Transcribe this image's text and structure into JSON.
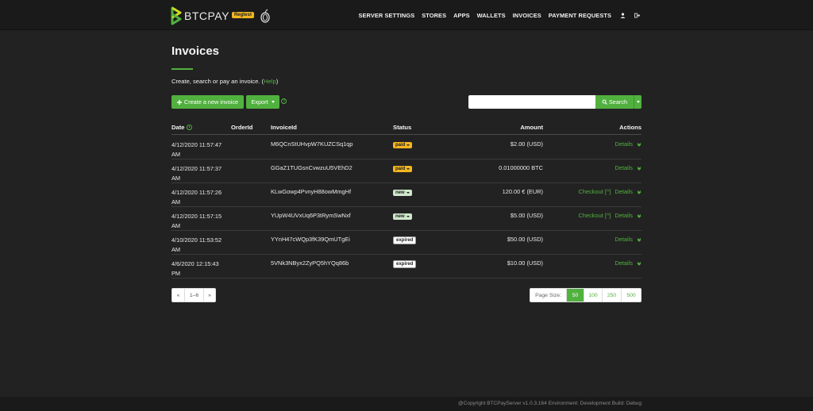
{
  "brand": {
    "name": "BTCPAY",
    "badge": "Regtest",
    "colors": {
      "accent": "#51b13e",
      "badge": "#f3b61f"
    }
  },
  "nav": {
    "items": [
      {
        "label": "SERVER SETTINGS"
      },
      {
        "label": "STORES"
      },
      {
        "label": "APPS"
      },
      {
        "label": "WALLETS"
      },
      {
        "label": "INVOICES"
      },
      {
        "label": "PAYMENT REQUESTS"
      }
    ],
    "icons": [
      "user-icon",
      "logout-icon"
    ]
  },
  "page": {
    "title": "Invoices",
    "subtitle_prefix": "Create, search or pay an invoice. (",
    "help_label": "Help",
    "subtitle_suffix": ")"
  },
  "toolbar": {
    "create_label": "Create a new invoice",
    "export_label": "Export",
    "search_value": "",
    "search_label": "Search"
  },
  "table": {
    "headers": {
      "date": "Date",
      "orderid": "OrderId",
      "invoiceid": "InvoiceId",
      "status": "Status",
      "amount": "Amount",
      "actions": "Actions"
    },
    "rows": [
      {
        "date": "4/12/2020 11:57:47 AM",
        "orderid": "",
        "invoiceid": "M6QCnStUHvpW7KUZCSq1qp",
        "status": "paid",
        "amount": "$2.00 (USD)",
        "checkout": "",
        "details": "Details"
      },
      {
        "date": "4/12/2020 11:57:37 AM",
        "orderid": "",
        "invoiceid": "GGaZ1TUGsnCvwzuU5VEhD2",
        "status": "paid",
        "amount": "0.01000000 BTC",
        "checkout": "",
        "details": "Details"
      },
      {
        "date": "4/12/2020 11:57:26 AM",
        "orderid": "",
        "invoiceid": "KLwGowp4PvnyH88owMmgHf",
        "status": "new",
        "amount": "120.00 € (EUR)",
        "checkout": "Checkout [^]",
        "details": "Details"
      },
      {
        "date": "4/12/2020 11:57:15 AM",
        "orderid": "",
        "invoiceid": "YUpW4UVxUq6P3tRymSwNxf",
        "status": "new",
        "amount": "$5.00 (USD)",
        "checkout": "Checkout [^]",
        "details": "Details"
      },
      {
        "date": "4/10/2020 11:53:52 AM",
        "orderid": "",
        "invoiceid": "YYnH47cWQp3fK39QmUTgEi",
        "status": "expired",
        "amount": "$50.00 (USD)",
        "checkout": "",
        "details": "Details"
      },
      {
        "date": "4/6/2020 12:15:43 PM",
        "orderid": "",
        "invoiceid": "5VNk3NByx2ZyPQ5hYQq86b",
        "status": "expired",
        "amount": "$10.00 (USD)",
        "checkout": "",
        "details": "Details"
      }
    ]
  },
  "pagination": {
    "prev": "«",
    "range": "1–6",
    "next": "»"
  },
  "pagesize": {
    "label": "Page Size:",
    "options": [
      "50",
      "100",
      "250",
      "500"
    ],
    "selected": "50"
  },
  "footer": {
    "text": "@Copyright BTCPayServer v1.0.3.164 Environment: Development Build: Debug"
  }
}
